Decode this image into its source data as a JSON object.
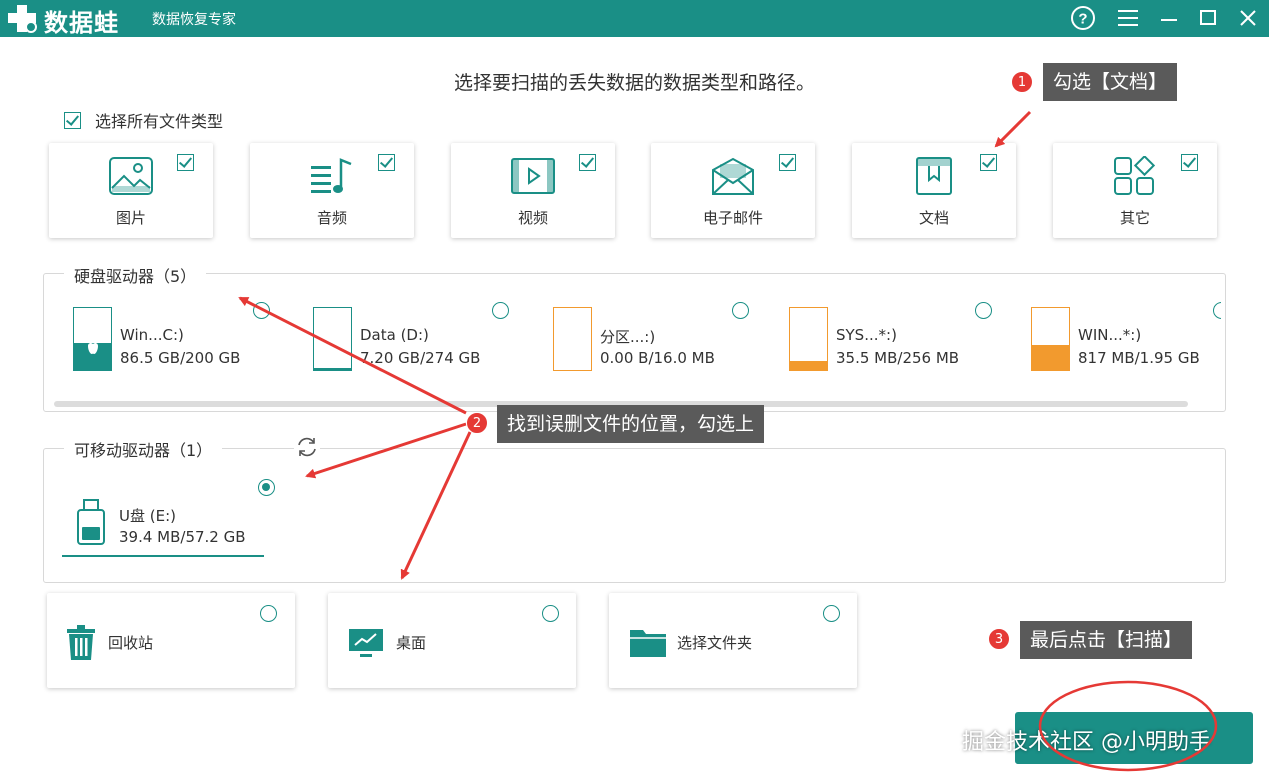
{
  "titlebar": {
    "app_name": "数据蛙",
    "subtitle": "数据恢复专家",
    "colors": {
      "brand": "#1a8f86",
      "text": "#ffffff"
    },
    "icons": [
      "help-icon",
      "menu-icon",
      "minimize-icon",
      "maximize-icon",
      "close-icon"
    ]
  },
  "page_title": "选择要扫描的丢失数据的数据类型和路径。",
  "select_all": {
    "label": "选择所有文件类型",
    "checked": true
  },
  "file_types": [
    {
      "label": "图片",
      "icon": "image-icon",
      "checked": true
    },
    {
      "label": "音频",
      "icon": "audio-icon",
      "checked": true
    },
    {
      "label": "视频",
      "icon": "video-icon",
      "checked": true
    },
    {
      "label": "电子邮件",
      "icon": "email-icon",
      "checked": true
    },
    {
      "label": "文档",
      "icon": "document-icon",
      "checked": true
    },
    {
      "label": "其它",
      "icon": "other-icon",
      "checked": true
    }
  ],
  "hard_drives": {
    "label": "硬盘驱动器（5）",
    "drives": [
      {
        "name": "Win...C:)",
        "size": "86.5 GB/200 GB",
        "fill": 0.43,
        "color": "#1a8f86",
        "selected": false
      },
      {
        "name": "Data (D:)",
        "size": "7.20 GB/274 GB",
        "fill": 0.03,
        "color": "#1a8f86",
        "selected": false
      },
      {
        "name": "分区...:)",
        "size": "0.00  B/16.0 MB",
        "fill": 0.0,
        "color": "#f29a2e",
        "selected": false
      },
      {
        "name": "SYS...*:)",
        "size": "35.5 MB/256 MB",
        "fill": 0.14,
        "color": "#f29a2e",
        "selected": false
      },
      {
        "name": "WIN...*:)",
        "size": "817 MB/1.95 GB",
        "fill": 0.41,
        "color": "#f29a2e",
        "selected": false
      }
    ]
  },
  "removable": {
    "label": "可移动驱动器（1）",
    "drives": [
      {
        "name": "U盘 (E:)",
        "size": "39.4 MB/57.2 GB",
        "selected": true
      }
    ]
  },
  "locations": [
    {
      "label": "回收站",
      "icon": "recycle-bin-icon",
      "selected": false
    },
    {
      "label": "桌面",
      "icon": "desktop-icon",
      "selected": false
    },
    {
      "label": "选择文件夹",
      "icon": "folder-icon",
      "selected": false
    }
  ],
  "annotations": {
    "step1": {
      "number": "1",
      "text": "勾选【文档】"
    },
    "step2": {
      "number": "2",
      "text": "找到误删文件的位置，勾选上"
    },
    "step3": {
      "number": "3",
      "text": "最后点击【扫描】"
    },
    "colors": {
      "arrow": "#e53935",
      "callout_bg": "#5a5a5a"
    }
  },
  "watermark": "掘金技术社区 @小明助手"
}
